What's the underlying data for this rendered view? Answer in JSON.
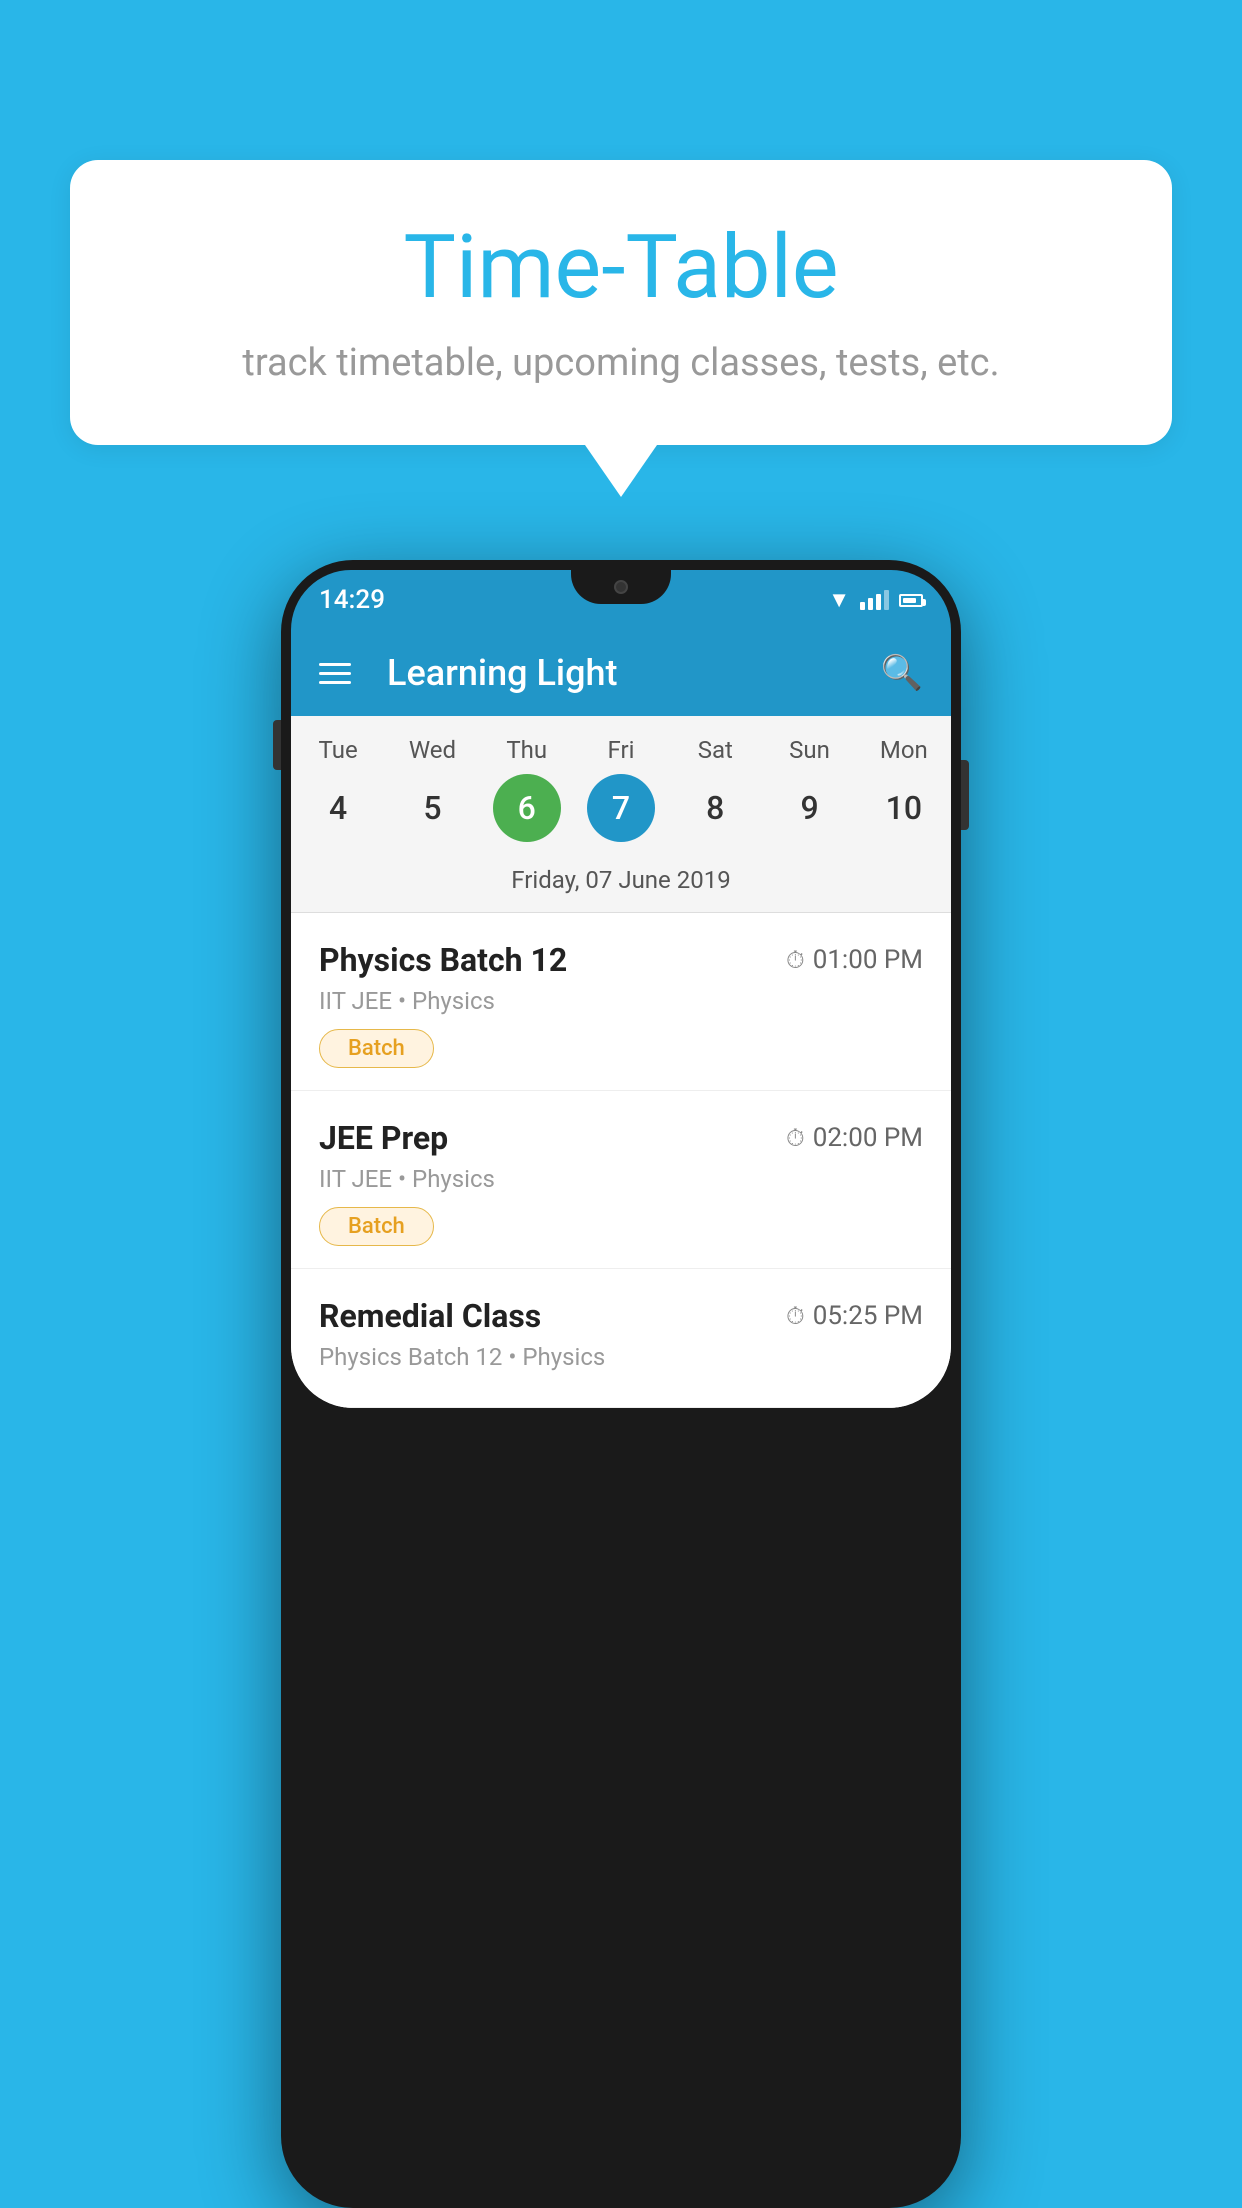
{
  "page": {
    "background_color": "#29B6E8"
  },
  "speech_bubble": {
    "title": "Time-Table",
    "subtitle": "track timetable, upcoming classes, tests, etc."
  },
  "phone": {
    "status_bar": {
      "time": "14:29"
    },
    "app_header": {
      "title": "Learning Light",
      "menu_label": "menu",
      "search_label": "search"
    },
    "calendar": {
      "days": [
        {
          "name": "Tue",
          "num": "4",
          "state": "normal"
        },
        {
          "name": "Wed",
          "num": "5",
          "state": "normal"
        },
        {
          "name": "Thu",
          "num": "6",
          "state": "today"
        },
        {
          "name": "Fri",
          "num": "7",
          "state": "selected"
        },
        {
          "name": "Sat",
          "num": "8",
          "state": "normal"
        },
        {
          "name": "Sun",
          "num": "9",
          "state": "normal"
        },
        {
          "name": "Mon",
          "num": "10",
          "state": "normal"
        }
      ],
      "selected_date_label": "Friday, 07 June 2019"
    },
    "schedule_items": [
      {
        "title": "Physics Batch 12",
        "time": "01:00 PM",
        "sub": "IIT JEE • Physics",
        "tag": "Batch"
      },
      {
        "title": "JEE Prep",
        "time": "02:00 PM",
        "sub": "IIT JEE • Physics",
        "tag": "Batch"
      },
      {
        "title": "Remedial Class",
        "time": "05:25 PM",
        "sub": "Physics Batch 12 • Physics",
        "tag": ""
      }
    ]
  }
}
